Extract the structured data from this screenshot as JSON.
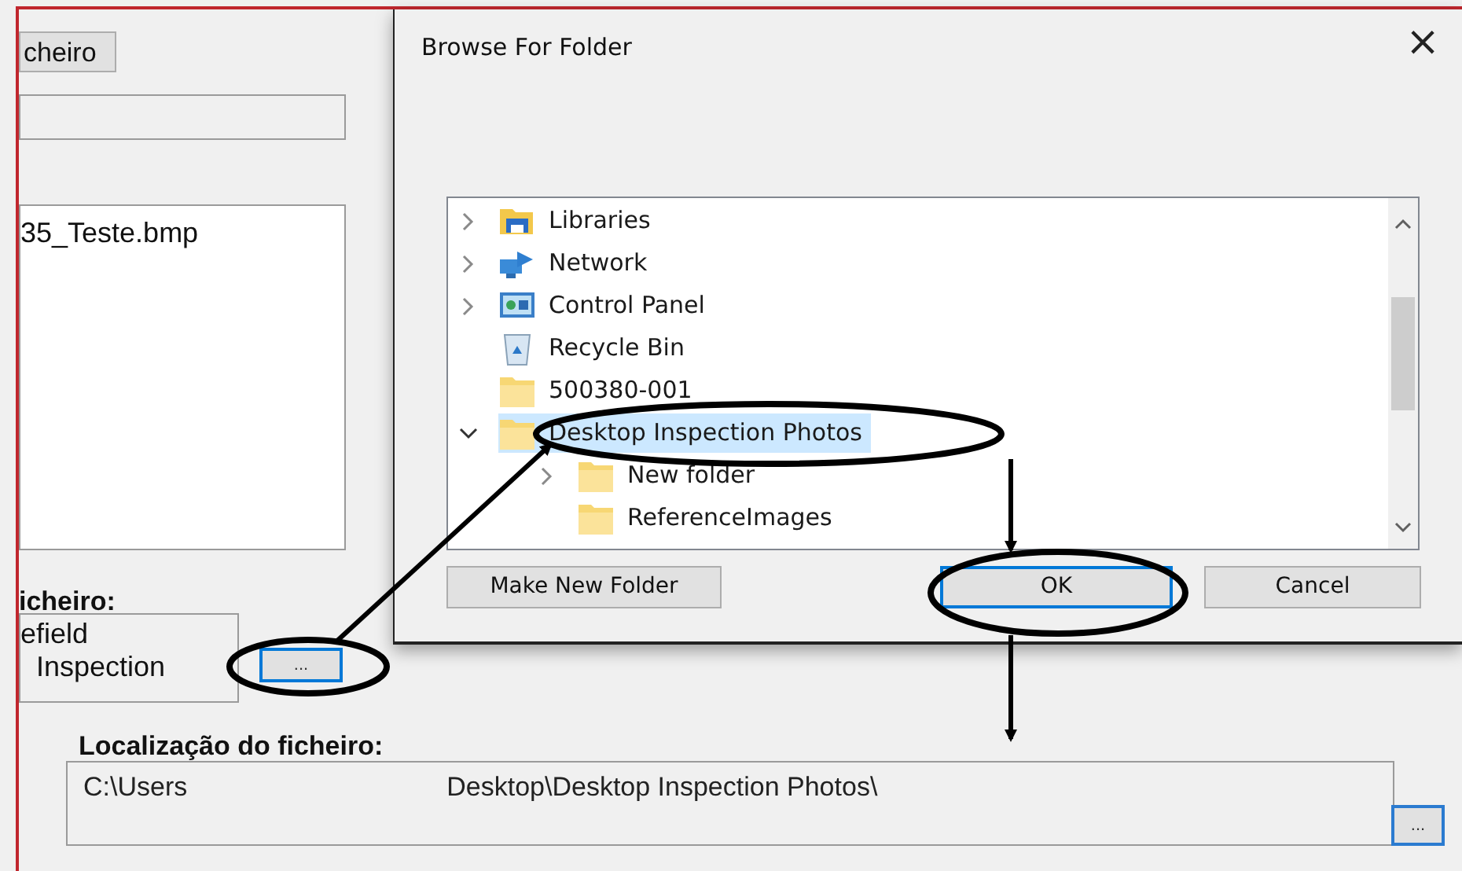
{
  "background_window": {
    "button": "cheiro",
    "list_items": [
      "35_Teste.bmp"
    ],
    "label": "icheiro:",
    "field_lines": [
      "efield",
      "Inspection"
    ],
    "browse_button": "..."
  },
  "dialog": {
    "title": "Browse For Folder",
    "close": "×",
    "tree": [
      {
        "label": "Libraries",
        "kind": "library",
        "expanded": false,
        "selected": false
      },
      {
        "label": "Network",
        "kind": "network",
        "expanded": false,
        "selected": false
      },
      {
        "label": "Control Panel",
        "kind": "control-panel",
        "expanded": false,
        "selected": false
      },
      {
        "label": "Recycle Bin",
        "kind": "recycle-bin",
        "selected": false
      },
      {
        "label": "500380-001",
        "kind": "folder",
        "selected": false
      },
      {
        "label": "Desktop Inspection Photos",
        "kind": "folder",
        "expanded": true,
        "selected": true,
        "children": [
          {
            "label": "New folder",
            "kind": "folder",
            "expanded": false,
            "selected": false
          },
          {
            "label": "ReferenceImages",
            "kind": "folder",
            "selected": false
          }
        ]
      }
    ],
    "buttons": [
      {
        "label": "Make New Folder",
        "focused": false
      },
      {
        "label": "OK",
        "focused": true
      },
      {
        "label": "Cancel",
        "focused": false
      }
    ]
  },
  "location_panel": {
    "label": "Localização do ficheiro:",
    "value_parts": [
      "C:\\Users",
      "Desktop\\Desktop Inspection Photos\\"
    ],
    "browse_button": "...",
    "browse_focused": true
  }
}
